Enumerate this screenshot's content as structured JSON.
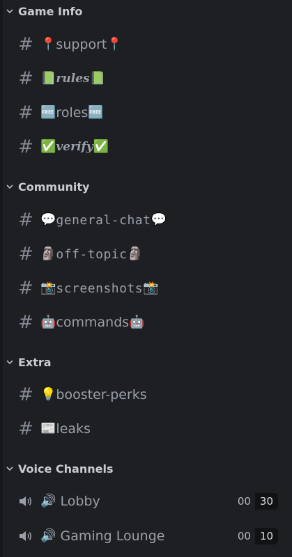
{
  "categories": [
    {
      "label": "Game Info",
      "channels": [
        {
          "pre": "📍",
          "name": "support",
          "post": "📍",
          "style": "plain"
        },
        {
          "pre": "📗",
          "name": "rules",
          "post": "📗",
          "style": "serif-bi"
        },
        {
          "pre": "🆓",
          "name": "roles",
          "post": "🆓",
          "style": "plain"
        },
        {
          "pre": "✅",
          "name": "verify",
          "post": "✅",
          "style": "serif-bi"
        }
      ]
    },
    {
      "label": "Community",
      "channels": [
        {
          "pre": "💬",
          "name": "general-chat",
          "post": "💬",
          "style": "mono"
        },
        {
          "pre": "🗿",
          "name": "off-topic",
          "post": "🗿",
          "style": "mono"
        },
        {
          "pre": "📸",
          "name": "screenshots",
          "post": "📸",
          "style": "mono"
        },
        {
          "pre": "🤖",
          "name": "commands",
          "post": "🤖",
          "style": "plain"
        }
      ]
    },
    {
      "label": "Extra",
      "channels": [
        {
          "pre": "💡",
          "name": "booster-perks",
          "post": "",
          "style": "plain"
        },
        {
          "pre": "📰",
          "name": "leaks",
          "post": "",
          "style": "plain"
        }
      ]
    },
    {
      "label": "Voice Channels",
      "voice": [
        {
          "pre": "🔊",
          "name": "Lobby",
          "count_a": "00",
          "count_b": "30"
        },
        {
          "pre": "🔊",
          "name": "Gaming Lounge",
          "count_a": "00",
          "count_b": "10"
        }
      ]
    }
  ],
  "icons": {
    "text_channel": "hash-icon",
    "voice_channel": "speaker-icon",
    "category": "chevron-down-icon"
  },
  "colors": {
    "background": "#1e1f23",
    "category_text": "#c8cbd1",
    "channel_text": "#9aa0a8"
  }
}
